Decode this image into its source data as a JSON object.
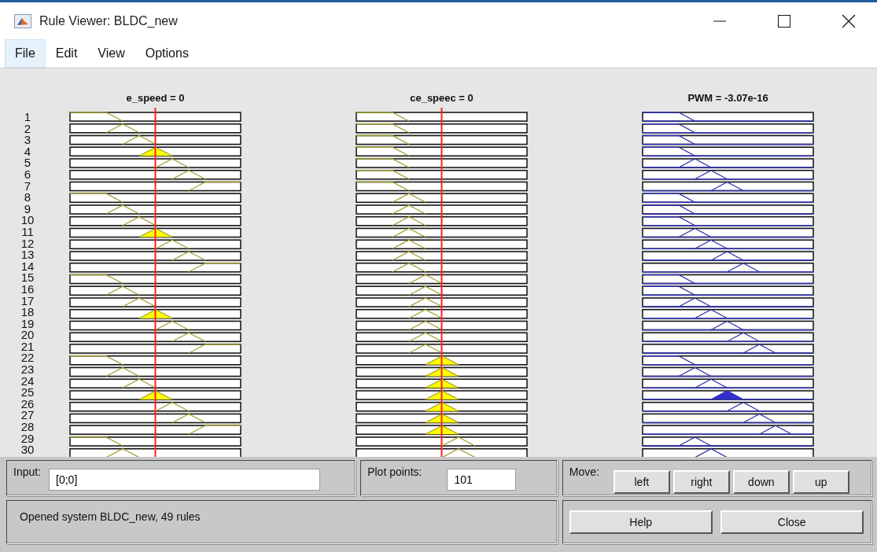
{
  "window": {
    "title": "Rule Viewer: BLDC_new"
  },
  "menu": [
    {
      "label": "File",
      "selected": true
    },
    {
      "label": "Edit",
      "selected": false
    },
    {
      "label": "View",
      "selected": false
    },
    {
      "label": "Options",
      "selected": false
    }
  ],
  "columns": [
    {
      "title": "e_speed = 0",
      "kind": "input"
    },
    {
      "title": "ce_speec = 0",
      "kind": "input"
    },
    {
      "title": "PWM = -3.07e-16",
      "kind": "output"
    }
  ],
  "rules": [
    "1",
    "2",
    "3",
    "4",
    "5",
    "6",
    "7",
    "8",
    "9",
    "10",
    "11",
    "12",
    "13",
    "14",
    "15",
    "16",
    "17",
    "18",
    "19",
    "20",
    "21",
    "22",
    "23",
    "24",
    "25",
    "26",
    "27",
    "28",
    "29",
    "30"
  ],
  "input": {
    "label": "Input:",
    "value": "[0;0]"
  },
  "plot_points": {
    "label": "Plot points:",
    "value": "101"
  },
  "move": {
    "label": "Move:",
    "buttons": [
      "left",
      "right",
      "down",
      "up"
    ]
  },
  "status": "Opened system BLDC_new, 49 rules",
  "buttons": [
    "Help",
    "Close"
  ]
}
